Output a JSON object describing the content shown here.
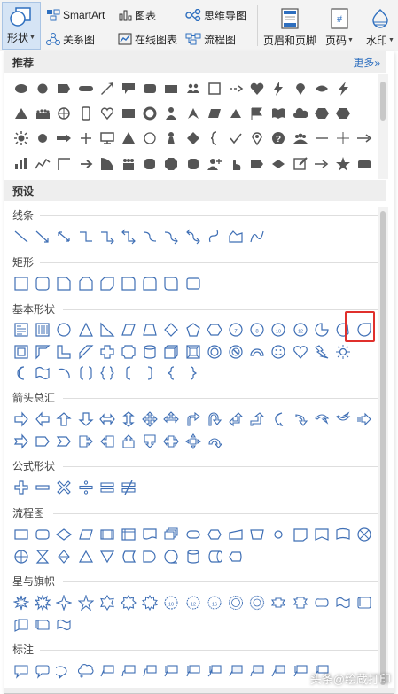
{
  "ribbon": {
    "shape": "形状",
    "smartart": "SmartArt",
    "chart": "图表",
    "mindmap": "思维导图",
    "relation": "关系图",
    "online_chart": "在线图表",
    "flowchart": "流程图",
    "header_footer": "页眉和页脚",
    "page_number": "页码",
    "watermark": "水印"
  },
  "panel": {
    "recommended": "推荐",
    "more": "更多",
    "more_glyph": "»",
    "presets": "预设"
  },
  "categories": [
    {
      "key": "lines",
      "label": "线条"
    },
    {
      "key": "rect",
      "label": "矩形"
    },
    {
      "key": "basic",
      "label": "基本形状"
    },
    {
      "key": "arrows",
      "label": "箭头总汇"
    },
    {
      "key": "equation",
      "label": "公式形状"
    },
    {
      "key": "flow",
      "label": "流程图"
    },
    {
      "key": "stars",
      "label": "星与旗帜"
    },
    {
      "key": "callouts",
      "label": "标注"
    }
  ],
  "badges": {
    "b7": "7",
    "b8": "8",
    "b10": "10",
    "b12": "12",
    "s10": "10",
    "s12": "12",
    "s16": "16"
  },
  "watermark_text": "头条@绘蔵打印",
  "colors": {
    "accent": "#2e6fbf",
    "highlight": "#e0302c",
    "ribbon_active": "#d5e4f5"
  }
}
